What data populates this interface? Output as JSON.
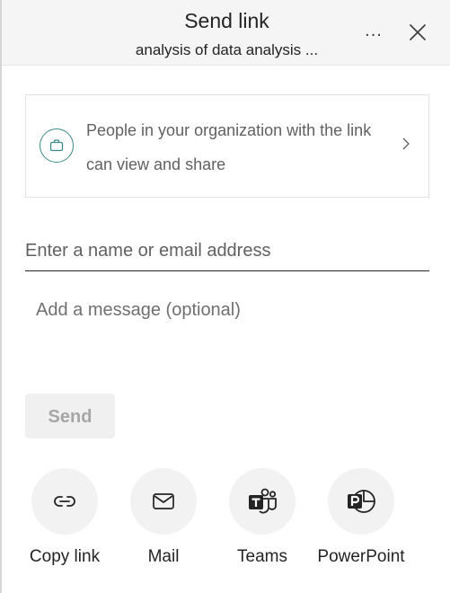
{
  "header": {
    "title": "Send link",
    "subtitle": "analysis of data analysis ...",
    "more_label": "...",
    "close_icon": "close-icon"
  },
  "permission": {
    "text_line1": "People in your organization with the link",
    "text_line2": "can view and share",
    "icon": "briefcase-icon",
    "accent": "#3b8a86"
  },
  "recipient": {
    "value": "",
    "placeholder": "Enter a name or email address"
  },
  "message": {
    "value": "",
    "placeholder": "Add a message (optional)"
  },
  "send": {
    "label": "Send",
    "enabled": false
  },
  "share_options": [
    {
      "label": "Copy link",
      "icon": "link-icon"
    },
    {
      "label": "Mail",
      "icon": "mail-icon"
    },
    {
      "label": "Teams",
      "icon": "teams-icon"
    },
    {
      "label": "PowerPoint",
      "icon": "powerpoint-icon"
    }
  ]
}
